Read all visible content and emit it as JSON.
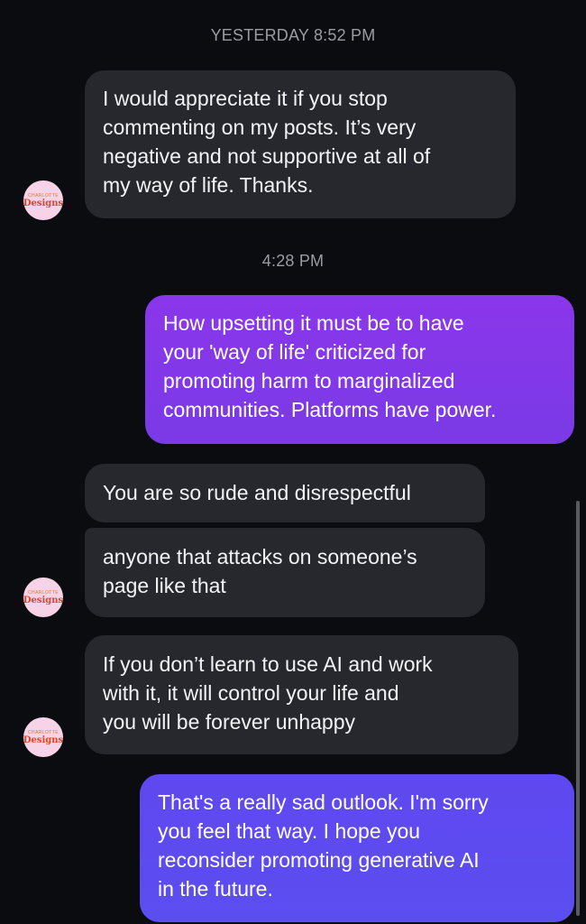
{
  "conversation": {
    "timestamps": [
      "YESTERDAY 8:52 PM",
      "4:28 PM"
    ],
    "avatar": {
      "top_text": "CHARLOTTE",
      "main_text": "Designs"
    },
    "messages": [
      {
        "sender": "them",
        "text": "I would appreciate it if you stop\ncommenting on my posts. It’s very\nnegative and not supportive at all of\nmy way of life. Thanks."
      },
      {
        "sender": "me",
        "text": "How upsetting it must be to have\nyour 'way of life' criticized for\npromoting harm to marginalized\ncommunities. Platforms have power."
      },
      {
        "sender": "them",
        "text": "You are so rude and disrespectful"
      },
      {
        "sender": "them",
        "text": "anyone that attacks on someone’s\npage like that"
      },
      {
        "sender": "them",
        "text": "If you don’t learn to use AI and work\nwith it, it will control your life and\nyou will be forever unhappy"
      },
      {
        "sender": "me",
        "text": "That's a really sad outlook. I'm sorry\nyou feel that way. I hope you\nreconsider promoting generative AI\nin the future."
      }
    ]
  },
  "colors": {
    "background": "#0b0c10",
    "incoming_bubble": "#26282d",
    "outgoing_gradient_top": "#8a38e9",
    "outgoing_gradient_bottom": "#5a4df0",
    "timestamp": "#9b9ca3"
  }
}
